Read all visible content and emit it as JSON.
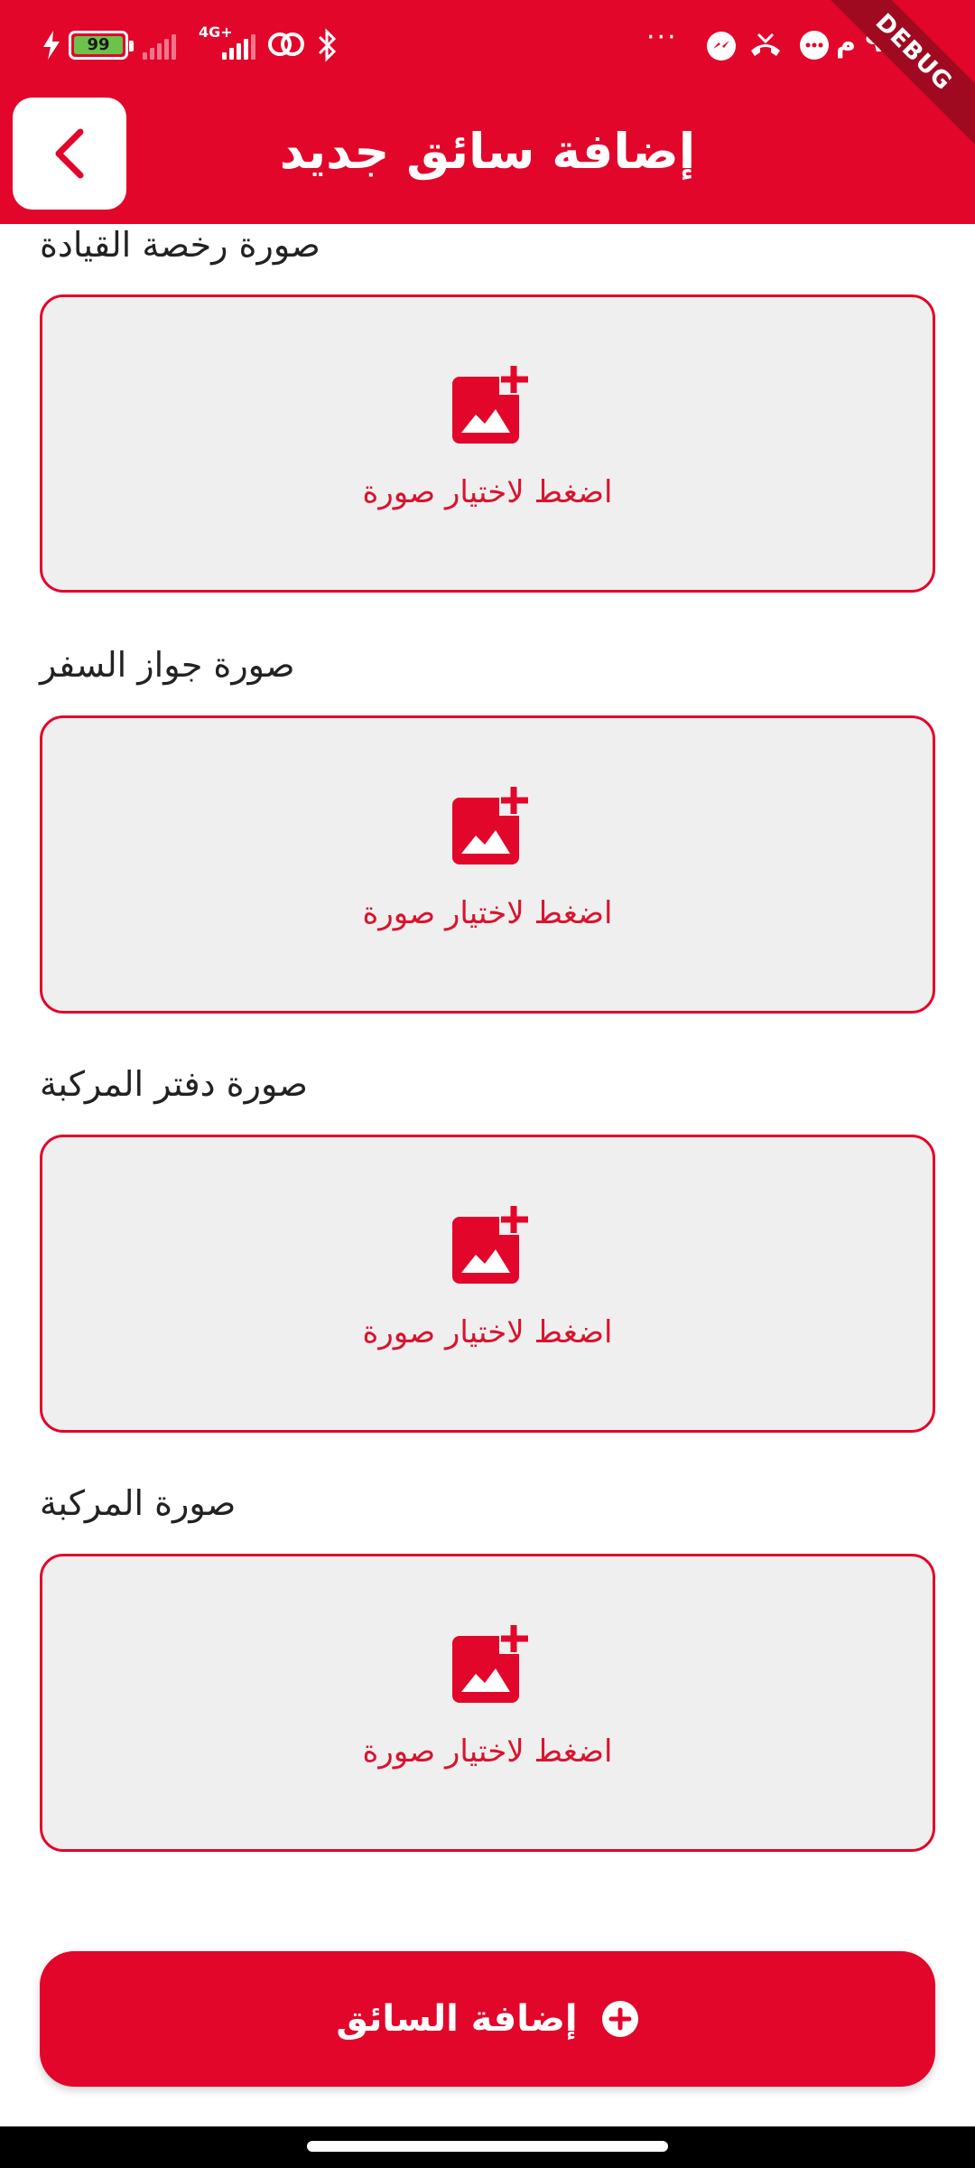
{
  "status_bar": {
    "battery": "99",
    "network": "4G+",
    "time": "٩:٠ م"
  },
  "debug_banner": "DEBUG",
  "header": {
    "title": "إضافة سائق جديد"
  },
  "sections": [
    {
      "label": "صورة رخصة القيادة",
      "hint": "اضغط لاختيار صورة"
    },
    {
      "label": "صورة جواز السفر",
      "hint": "اضغط لاختيار صورة"
    },
    {
      "label": "صورة دفتر المركبة",
      "hint": "اضغط لاختيار صورة"
    },
    {
      "label": "صورة المركبة",
      "hint": "اضغط لاختيار صورة"
    }
  ],
  "submit_button": {
    "label": "إضافة السائق"
  },
  "colors": {
    "primary": "#e2062a",
    "picker_background": "#efefef",
    "hint_text": "#d8142e"
  }
}
